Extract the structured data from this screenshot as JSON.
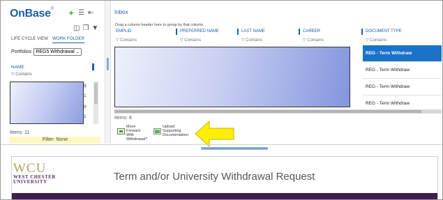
{
  "app": {
    "brand": "OnBase",
    "brand_mark": "®"
  },
  "left_panel": {
    "tabs": [
      "LIFE CYCLE VIEW",
      "WORK FOLDER"
    ],
    "portfolios_label": "Portfolios",
    "portfolio_value": "REG5 Withdrawal",
    "column_name": "NAME",
    "column_filter": "Contains",
    "edge_chars": [
      "g",
      "1",
      "9",
      "1"
    ],
    "items_count": "Items: 11",
    "filter_text": "Filter: None"
  },
  "inbox": {
    "title": "Inbox",
    "group_hint": "Drag a column header here to group by that column.",
    "columns": [
      {
        "label": "EMPLID",
        "filter": "Contains"
      },
      {
        "label": "PREFERRED NAME",
        "filter": "Contains"
      },
      {
        "label": "LAST NAME",
        "filter": "Contains"
      },
      {
        "label": "CAREER",
        "filter": "Contains"
      },
      {
        "label": "DOCUMENT TYPE",
        "filter": "Contains"
      }
    ],
    "document_rows": [
      "REG - Term Withdraw",
      "REG - Term Withdraw",
      "REG - Term Withdraw",
      "REG - Term Withdraw"
    ],
    "items_count": "Items: 8",
    "actions": [
      {
        "label_lines": [
          "Move",
          "Forward",
          "With",
          "Withdrawal?"
        ]
      },
      {
        "label_lines": [
          "Upload",
          "Supporting",
          "Documentation"
        ]
      }
    ]
  },
  "form": {
    "logo_big": "WCU",
    "logo_small_1": "WEST CHESTER",
    "logo_small_2": "UNIVERSITY",
    "title": "Term and/or University Withdrawal Request"
  },
  "colors": {
    "accent": "#1b5fa8",
    "selected_row": "#1a73c8",
    "arrow": "#ffee00",
    "banner": "#3d1e4f"
  }
}
